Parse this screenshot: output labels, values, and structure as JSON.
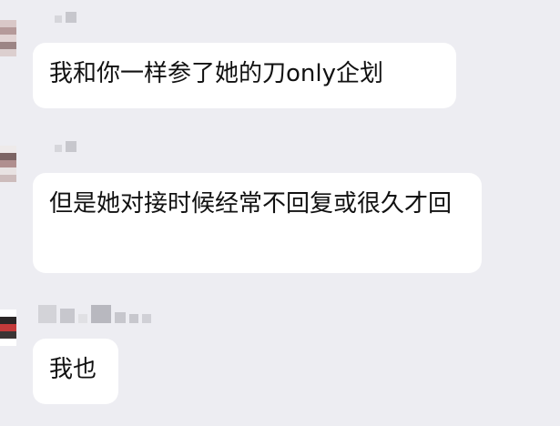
{
  "messages": [
    {
      "text": "我和你一样参了她的刀only企划"
    },
    {
      "text": "但是她对接时候经常不回复或很久才回"
    },
    {
      "text": "我也"
    }
  ],
  "colors": {
    "background": "#ededf2",
    "bubble": "#ffffff",
    "text": "#111111",
    "blur": "#c7c7cd"
  }
}
